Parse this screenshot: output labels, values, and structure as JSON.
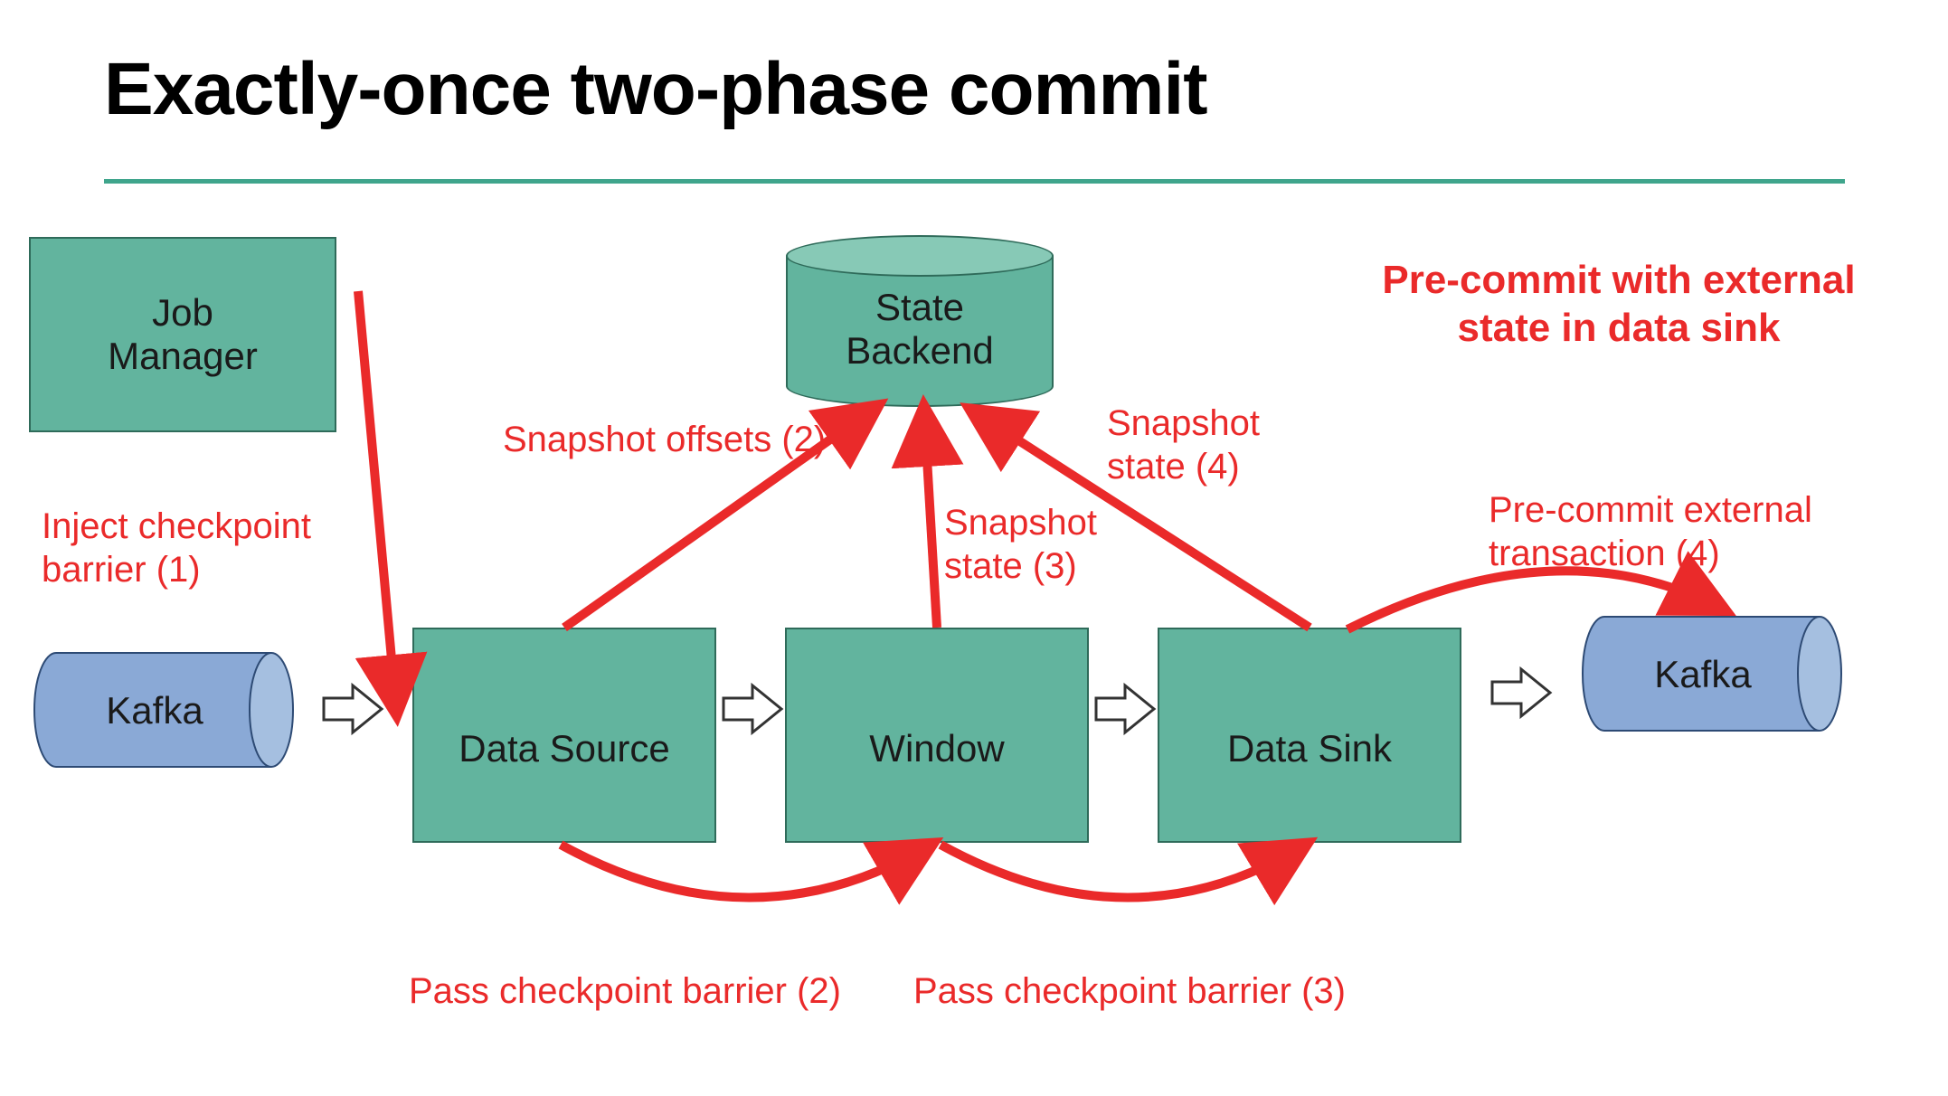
{
  "title": "Exactly-once two-phase commit",
  "nodes": {
    "job_manager": "Job\nManager",
    "state_backend": "State\nBackend",
    "kafka_left": "Kafka",
    "kafka_right": "Kafka",
    "data_source": "Data Source",
    "window": "Window",
    "data_sink": "Data Sink"
  },
  "annotations": {
    "heading": "Pre-commit with external\nstate in data sink",
    "inject": "Inject checkpoint\nbarrier (1)",
    "snapshot_offsets": "Snapshot offsets (2)",
    "snapshot_state_3": "Snapshot\nstate (3)",
    "snapshot_state_4": "Snapshot\nstate (4)",
    "precommit_ext": "Pre-commit external\ntransaction (4)",
    "pass_barrier_2": "Pass checkpoint barrier (2)",
    "pass_barrier_3": "Pass checkpoint barrier (3)"
  }
}
